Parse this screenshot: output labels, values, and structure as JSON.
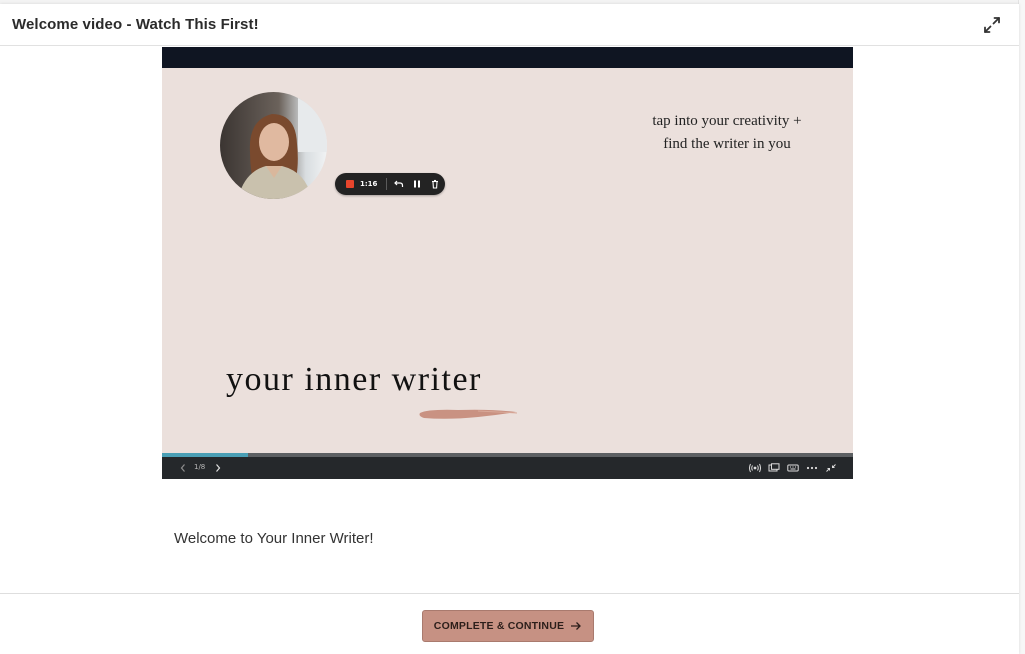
{
  "header": {
    "title": "Welcome video - Watch This First!",
    "expand_icon": "expand-arrows-icon"
  },
  "video": {
    "recorder": {
      "time": "1:16",
      "icons": [
        "record-stop-icon",
        "undo-icon",
        "pause-icon",
        "trash-icon"
      ]
    },
    "slide": {
      "tagline_line1": "tap into your creativity +",
      "tagline_line2": "find the writer in you",
      "title": "your inner writer"
    },
    "progress_fraction": 0.125,
    "controls": {
      "slide_counter": "1/8",
      "icons": [
        "chevron-left-icon",
        "chevron-right-icon",
        "broadcast-icon",
        "captions-icon",
        "keyboard-icon",
        "more-icon",
        "collapse-icon"
      ]
    }
  },
  "body": {
    "welcome_text": "Welcome to Your Inner Writer!"
  },
  "footer": {
    "continue_label": "COMPLETE & CONTINUE",
    "continue_icon": "arrow-right-icon"
  },
  "colors": {
    "accent_button": "#c69183",
    "slide_background": "#ebe0dc",
    "progress": "#4a9fb5",
    "recording": "#e8452c"
  }
}
